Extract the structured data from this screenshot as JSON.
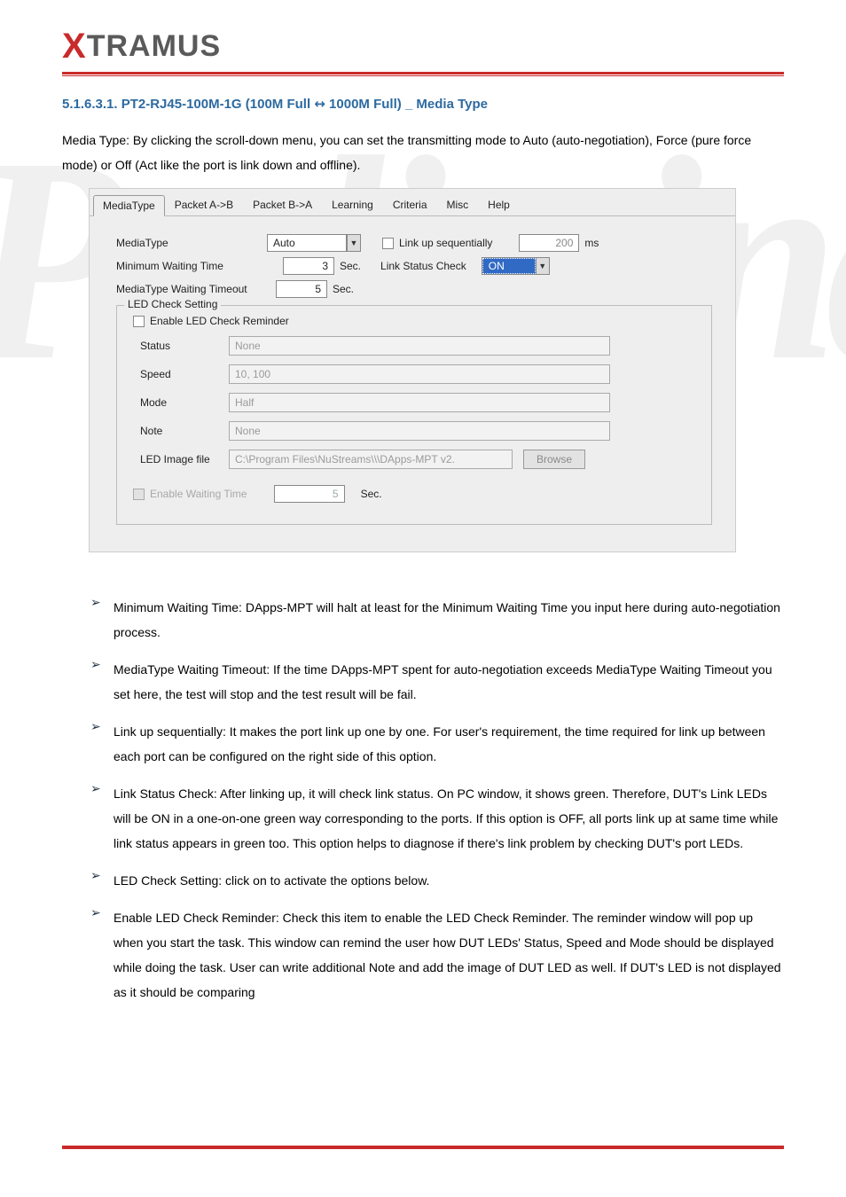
{
  "logo_prefix": "X",
  "logo_rest": "TRAMUS",
  "section_title_prefix": "5.1.6.3.1. PT2-RJ45-100M-1G (100M Full",
  "section_arrow": "↔",
  "section_title_suffix": "1000M Full) _ Media Type",
  "intro": "Media Type: By clicking the scroll-down menu, you can set the transmitting mode to Auto (auto-negotiation), Force (pure force mode) or Off (Act like the port is link down and offline).",
  "tabs": [
    "MediaType",
    "Packet A->B",
    "Packet B->A",
    "Learning",
    "Criteria",
    "Misc",
    "Help"
  ],
  "form": {
    "mediatype_lbl": "MediaType",
    "mediatype_val": "Auto",
    "linkup_lbl": "Link up sequentially",
    "linkup_ms_val": "200",
    "linkup_ms_unit": "ms",
    "minwait_lbl": "Minimum Waiting Time",
    "minwait_val": "3",
    "sec": "Sec.",
    "linkstatus_lbl": "Link Status Check",
    "linkstatus_val": "ON",
    "mwt_lbl": "MediaType Waiting Timeout",
    "mwt_val": "5",
    "led_legend": "LED Check Setting",
    "led_enable_lbl": "Enable LED Check Reminder",
    "status_lbl": "Status",
    "status_val": "None",
    "speed_lbl": "Speed",
    "speed_val": "10, 100",
    "mode_lbl": "Mode",
    "mode_val": "Half",
    "note_lbl": "Note",
    "note_val": "None",
    "ledimg_lbl": "LED Image file",
    "ledimg_val": "C:\\Program Files\\NuStreams\\\\\\DApps-MPT v2.",
    "browse": "Browse",
    "ewt_lbl": "Enable Waiting Time",
    "ewt_val": "5"
  },
  "bullets": [
    "Minimum Waiting Time: DApps-MPT will halt at least for the Minimum Waiting Time you input here during auto-negotiation process.",
    "MediaType Waiting Timeout: If the time DApps-MPT spent for auto-negotiation exceeds MediaType Waiting Timeout you set here, the test will stop and the test result will be fail.",
    "Link up sequentially: It makes the port link up one by one. For user's requirement, the time required for link up between each port can be configured on the right side of this option.",
    "Link Status Check: After linking up, it will check link status. On PC window, it shows green. Therefore, DUT's Link LEDs will be ON in a one-on-one green way corresponding to the ports. If this option is OFF, all ports link up at same time while link status appears in green too. This option helps to diagnose if there's link problem by checking DUT's port LEDs.",
    "LED Check Setting: click on to activate the options below.",
    "Enable LED Check Reminder: Check this item to enable the LED Check Reminder. The reminder window will pop up when you start the task. This window can remind the user how DUT LEDs' Status, Speed and Mode should be displayed while doing the task. User can write additional Note and add the image of DUT LED as well. If DUT's LED is not displayed as it should be comparing"
  ]
}
